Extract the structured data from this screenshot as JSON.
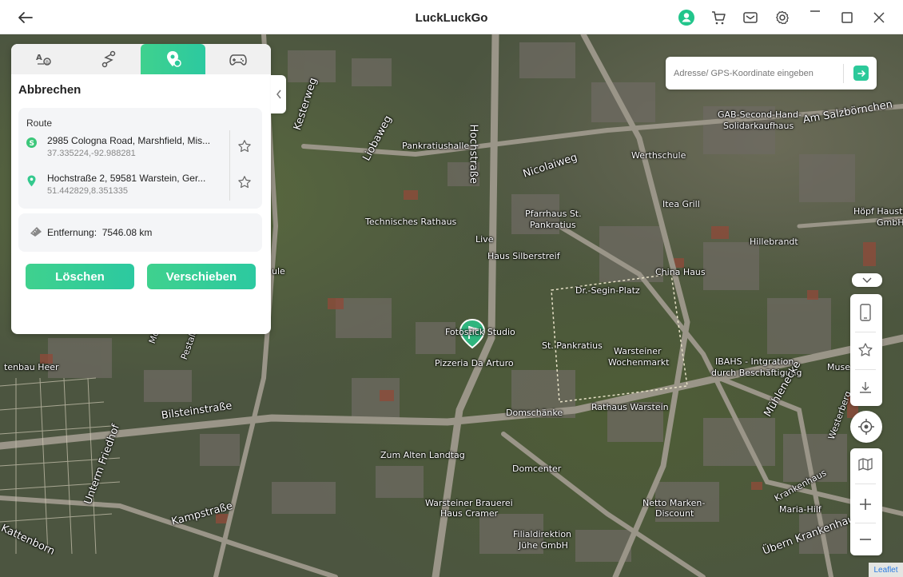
{
  "app": {
    "title": "LuckLuckGo"
  },
  "titlebar_icons": [
    "back-arrow-icon",
    "user-avatar-icon",
    "cart-icon",
    "mail-icon",
    "settings-icon",
    "minimize-icon",
    "maximize-icon",
    "close-icon"
  ],
  "panel": {
    "tabs": [
      "teleport-mode",
      "two-spot-mode",
      "multi-spot-mode",
      "joystick-mode"
    ],
    "heading": "Abbrechen",
    "route_label": "Route",
    "start": {
      "address": "2985 Cologna Road, Marshfield, Mis...",
      "coords": "37.335224,-92.988281"
    },
    "end": {
      "address": "Hochstraße 2, 59581 Warstein, Ger...",
      "coords": "51.442829,8.351335"
    },
    "distance_label": "Entfernung:",
    "distance_value": "7546.08 km",
    "delete_label": "Löschen",
    "move_label": "Verschieben"
  },
  "search": {
    "placeholder": "Adresse/ GPS-Koordinate eingeben"
  },
  "map": {
    "labels": [
      "Kesterweg",
      "Liobaweg",
      "Hochstraße",
      "Pankratiushalle",
      "Nicolaiweg",
      "Technisches Rathaus",
      "Pfarrhaus St.",
      "Pankratius",
      "Live",
      "Haus Silberstreif",
      "Dr.-Segin-Platz",
      "Fotostick Studio",
      "St. Pankratius",
      "Pizzeria Da Arturo",
      "Warsteiner",
      "Wochenmarkt",
      "Domschänke",
      "Rathaus Warstein",
      "Bilsteinstraße",
      "Zum Alten Landtag",
      "Domcenter",
      "Warsteiner Brauerei",
      "Haus Cramer",
      "Kampstraße",
      "Kattenborn",
      "Unterm Friedhof",
      "Mönchlur",
      "Pestalozziweg",
      "Netto Marken-",
      "Discount",
      "Filialdirektion",
      "Jühe GmbH",
      "Werthschule",
      "Am Salzbörnchen",
      "GAB-Second-Hand-",
      "Solidarkaufhaus",
      "Itea Grill",
      "Hillebrandt",
      "China Haus",
      "IBAHS - Intgration",
      "durch Beschäftigung",
      "Krankenhaus",
      "Maria-Hilf",
      "Mühlenecke",
      "Übern Krankenhaus",
      "Höpf Hauste",
      "GmbH",
      "Westerberg",
      "tenbau Heer",
      "ule",
      "Muse"
    ],
    "attribution": "Leaflet"
  },
  "colors": {
    "accent": "#2cc99a",
    "start_marker": "#3cc77a",
    "end_marker": "#34c98e"
  }
}
